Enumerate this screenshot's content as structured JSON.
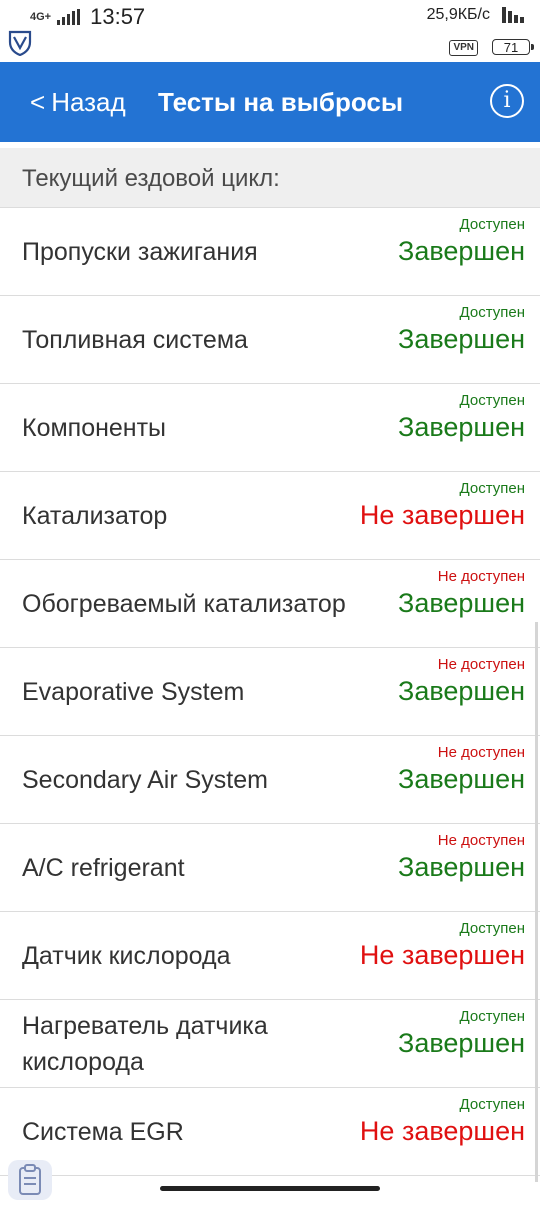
{
  "status_bar": {
    "network": "4G+",
    "time": "13:57",
    "speed": "25,9КБ/с",
    "vpn": "VPN",
    "battery": "71"
  },
  "header": {
    "back_label": "Назад",
    "title": "Тесты на выбросы",
    "info_label": "i"
  },
  "section": {
    "title": "Текущий ездовой цикл:"
  },
  "tests": [
    {
      "name": "Пропуски зажигания",
      "availability": "Доступен",
      "status": "Завершен"
    },
    {
      "name": "Топливная система",
      "availability": "Доступен",
      "status": "Завершен"
    },
    {
      "name": "Компоненты",
      "availability": "Доступен",
      "status": "Завершен"
    },
    {
      "name": "Катализатор",
      "availability": "Доступен",
      "status": "Не завершен"
    },
    {
      "name": "Обогреваемый катализатор",
      "availability": "Не доступен",
      "status": "Завершен"
    },
    {
      "name": "Evaporative System",
      "availability": "Не доступен",
      "status": "Завершен"
    },
    {
      "name": "Secondary Air System",
      "availability": "Не доступен",
      "status": "Завершен"
    },
    {
      "name": "A/C refrigerant",
      "availability": "Не доступен",
      "status": "Завершен"
    },
    {
      "name": "Датчик кислорода",
      "availability": "Доступен",
      "status": "Не завершен"
    },
    {
      "name": "Нагреватель датчика кислорода",
      "availability": "Доступен",
      "status": "Завершен"
    },
    {
      "name": "Система EGR",
      "availability": "Доступен",
      "status": "Не завершен"
    }
  ],
  "colors": {
    "appbar": "#2373d3",
    "ok": "#1a7a1a",
    "fail": "#e01010"
  }
}
